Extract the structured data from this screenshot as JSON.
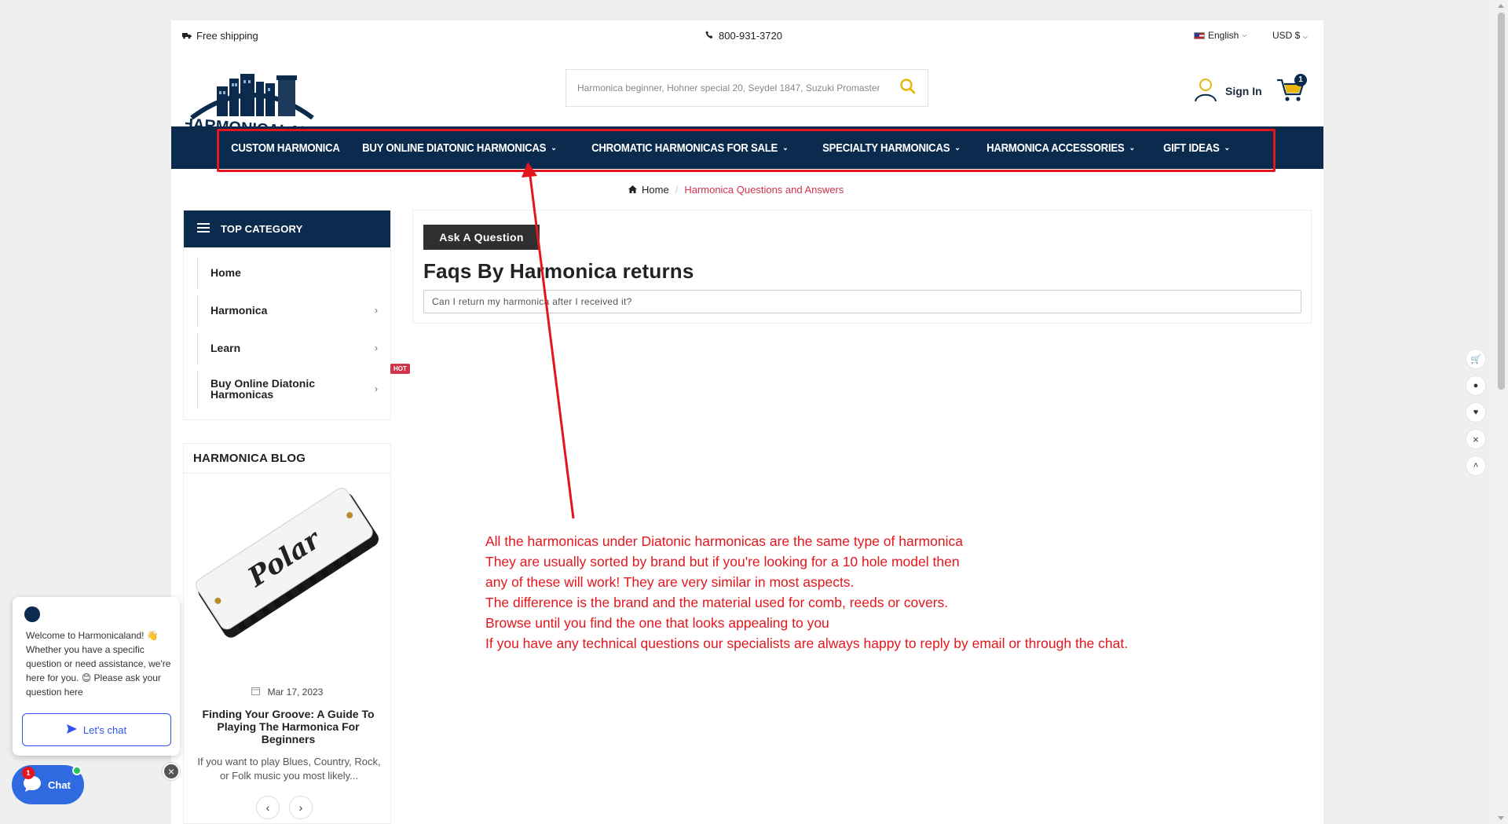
{
  "topbar": {
    "shipping": "Free shipping",
    "phone": "800-931-3720",
    "language": "English",
    "currency": "USD $"
  },
  "header": {
    "logo_text": "HARMONICALAND",
    "search_placeholder": "Harmonica beginner, Hohner special 20, Seydel 1847, Suzuki Promaster",
    "sign_in": "Sign In",
    "cart_count": "1"
  },
  "nav": {
    "items": [
      {
        "label": "CUSTOM HARMONICA",
        "has_dropdown": false
      },
      {
        "label": "BUY ONLINE DIATONIC HARMONICAS",
        "has_dropdown": true
      },
      {
        "label": "CHROMATIC HARMONICAS FOR SALE",
        "has_dropdown": true
      },
      {
        "label": "SPECIALTY HARMONICAS",
        "has_dropdown": true
      },
      {
        "label": "HARMONICA ACCESSORIES",
        "has_dropdown": true
      },
      {
        "label": "GIFT IDEAS",
        "has_dropdown": true
      }
    ],
    "highlight_color": "#e4161d"
  },
  "breadcrumb": {
    "home": "Home",
    "current": "Harmonica Questions and Answers"
  },
  "sidebar": {
    "title": "TOP CATEGORY",
    "items": [
      {
        "label": "Home"
      },
      {
        "label": "Harmonica"
      },
      {
        "label": "Learn"
      },
      {
        "label": "Buy Online Diatonic Harmonicas",
        "badge": "HOT"
      }
    ]
  },
  "blog": {
    "title": "HARMONICA BLOG",
    "image_text": "Polar",
    "date": "Mar 17, 2023",
    "post_title": "Finding Your Groove: A Guide To Playing The Harmonica For Beginners",
    "excerpt": "If you want to play Blues, Country, Rock, or Folk music you most likely..."
  },
  "main": {
    "ask_button": "Ask A Question",
    "faq_title": "Faqs By Harmonica returns",
    "question": "Can I return my harmonica after I received it?"
  },
  "annotation": {
    "color": "#e4161d",
    "lines": [
      "All the harmonicas under Diatonic harmonicas are the same type of harmonica",
      "They are usually sorted by brand but if you're looking for a 10 hole model then",
      "any of these will work! They are very similar in most aspects.",
      "The difference is the brand and the material used for comb, reeds or covers.",
      "Browse until you find the one that looks appealing to you",
      "If you have any technical questions our specialists are always happy to reply by email or through the chat."
    ]
  },
  "chat": {
    "welcome": "Welcome to Harmonicaland! 👋 Whether you have a specific question or need assistance, we're here for you. 😊 Please ask your question here",
    "button": "Let's chat",
    "launcher": "Chat",
    "badge": "1",
    "close": "×"
  },
  "colors": {
    "brand_navy": "#0b2b4e",
    "accent_pink": "#d0334a",
    "chat_blue": "#2f6ae0"
  }
}
